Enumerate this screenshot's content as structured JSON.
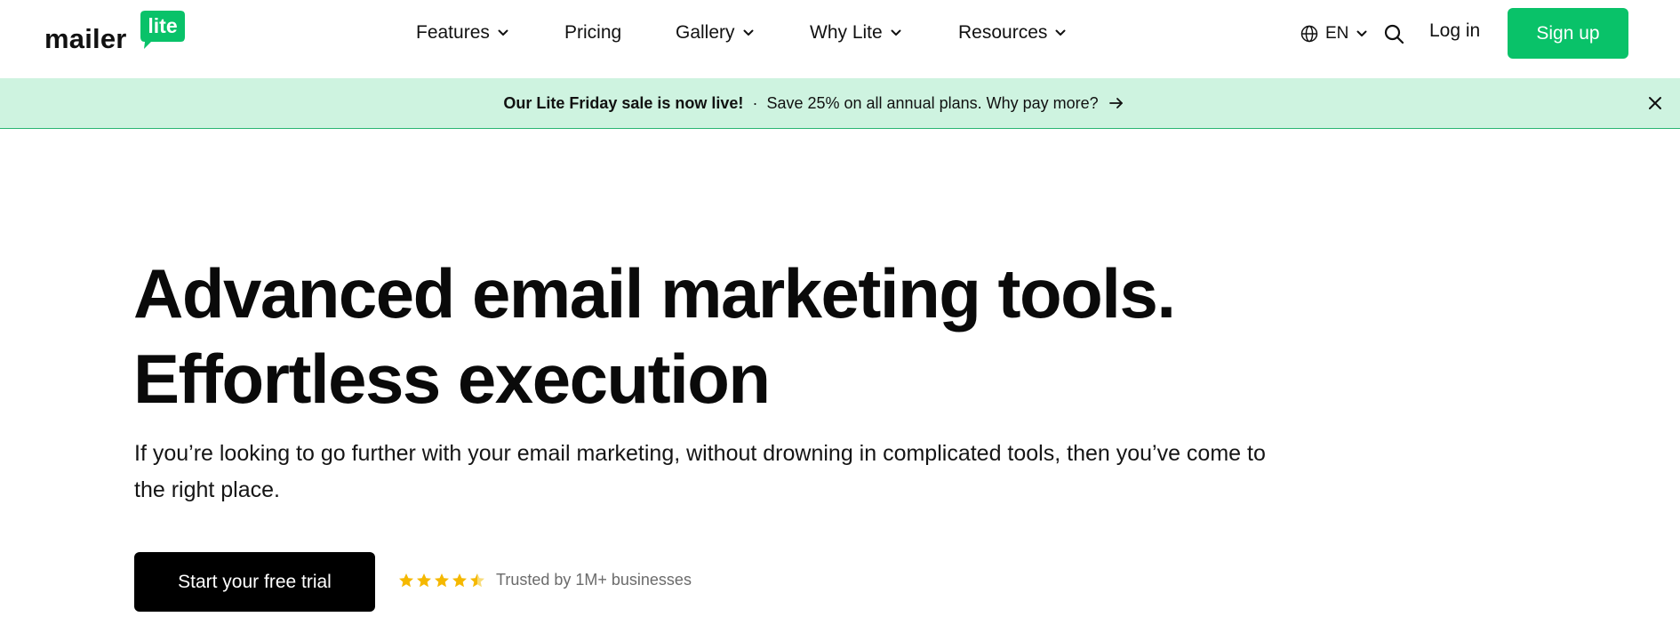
{
  "brand": {
    "word": "mailer",
    "badge": "lite",
    "color": "#09c269"
  },
  "nav": {
    "features": "Features",
    "pricing": "Pricing",
    "gallery": "Gallery",
    "why_lite": "Why Lite",
    "resources": "Resources"
  },
  "header_right": {
    "language": "EN",
    "login": "Log in",
    "signup": "Sign up"
  },
  "banner": {
    "headline": "Our Lite Friday sale is now live!",
    "separator": "·",
    "message": "Save 25% on all annual plans. Why pay more?",
    "background": "#cef3e0"
  },
  "hero": {
    "title_line1": "Advanced email marketing tools.",
    "title_line2": "Effortless execution",
    "subtitle": "If you’re looking to go further with your email marketing, without drowning in complicated tools, then you’ve come to the right place.",
    "cta": "Start your free trial",
    "rating_value": 4.5,
    "rating_max": 5,
    "star_color": "#f5b800",
    "trust": "Trusted by 1M+ businesses"
  },
  "icons": {
    "globe": "globe-icon",
    "search": "search-icon",
    "chevron": "chevron-down-icon",
    "arrow": "arrow-right-icon",
    "close": "close-icon",
    "star": "star-icon"
  }
}
